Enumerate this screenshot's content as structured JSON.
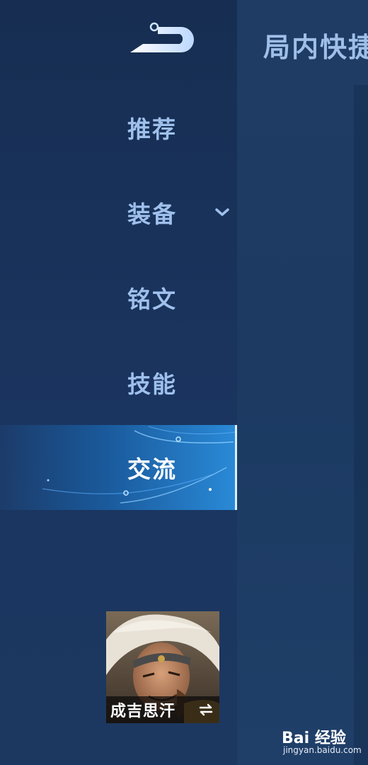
{
  "header": {
    "title": "局内快捷"
  },
  "nav": {
    "items": [
      {
        "label": "推荐",
        "active": false
      },
      {
        "label": "装备",
        "active": false,
        "expandable": true
      },
      {
        "label": "铭文",
        "active": false
      },
      {
        "label": "技能",
        "active": false
      },
      {
        "label": "交流",
        "active": true
      }
    ]
  },
  "hero": {
    "name": "成吉思汗",
    "switch_icon": "swap-icon"
  },
  "watermark": {
    "brand": "Bai 经验",
    "url": "jingyan.baidu.com"
  },
  "colors": {
    "nav_text": "#9fc0ec",
    "active_text": "#ffffff",
    "accent": "#2a8ad8"
  }
}
